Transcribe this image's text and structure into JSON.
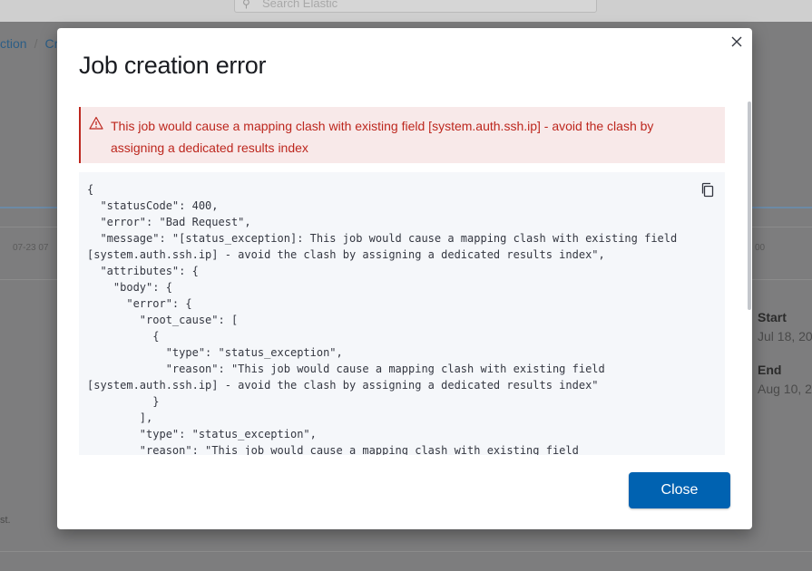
{
  "background": {
    "search_placeholder": "Search Elastic",
    "breadcrumb": [
      "ction",
      "Cr"
    ],
    "axis_left": "07-23 07",
    "axis_right": "00",
    "start_label": "Start",
    "start_value": "Jul 18, 20",
    "end_label": "End",
    "end_value": "Aug 10, 2",
    "footnote": "st."
  },
  "modal": {
    "title": "Job creation error",
    "callout_icon": "warning-icon",
    "callout_text": "This job would cause a mapping clash with existing field [system.auth.ssh.ip] - avoid the clash by assigning a dedicated results index",
    "code_lines": [
      "{",
      "  \"statusCode\": 400,",
      "  \"error\": \"Bad Request\",",
      "  \"message\": \"[status_exception]: This job would cause a mapping clash with existing field",
      "[system.auth.ssh.ip] - avoid the clash by assigning a dedicated results index\",",
      "  \"attributes\": {",
      "    \"body\": {",
      "      \"error\": {",
      "        \"root_cause\": [",
      "          {",
      "            \"type\": \"status_exception\",",
      "            \"reason\": \"This job would cause a mapping clash with existing field",
      "[system.auth.ssh.ip] - avoid the clash by assigning a dedicated results index\"",
      "          }",
      "        ],",
      "        \"type\": \"status_exception\",",
      "        \"reason\": \"This job would cause a mapping clash with existing field"
    ],
    "close_button": "Close",
    "colors": {
      "danger": "#bd271e",
      "callout_bg": "#f8e9e9",
      "primary": "#0062b1",
      "code_bg": "#f5f7fa"
    }
  }
}
